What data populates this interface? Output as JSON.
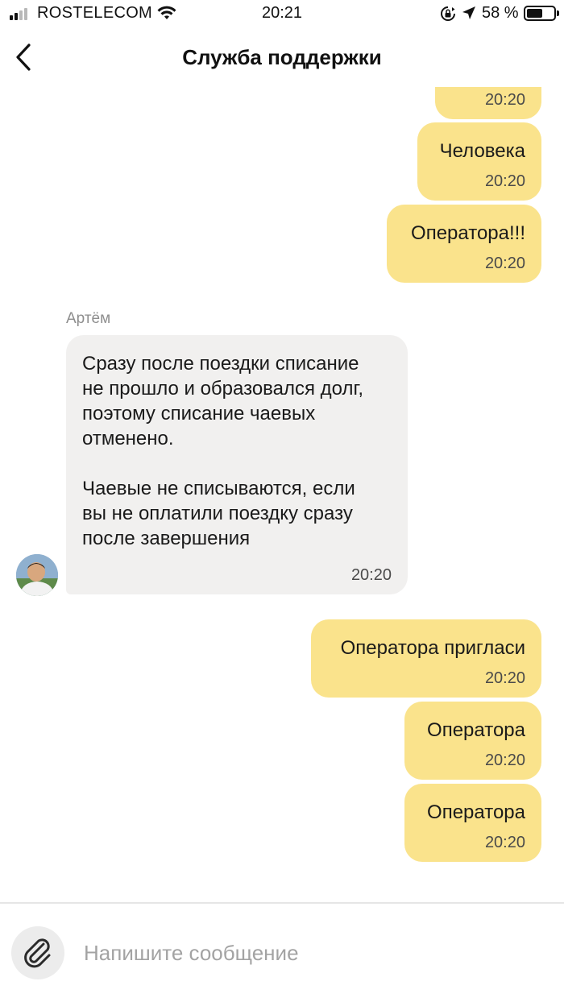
{
  "status_bar": {
    "carrier": "ROSTELECOM",
    "time": "20:21",
    "battery": "58 %"
  },
  "header": {
    "title": "Служба поддержки",
    "back_icon": "chevron-left-icon"
  },
  "messages": [
    {
      "direction": "out",
      "text": "",
      "time": "20:20"
    },
    {
      "direction": "out",
      "text": "Человека",
      "time": "20:20"
    },
    {
      "direction": "out",
      "text": "Оператора!!!",
      "time": "20:20"
    },
    {
      "direction": "in",
      "sender": "Артём",
      "text": "Сразу после поездки списание\nне прошло и образовался долг,\nпоэтому списание чаевых\nотменено.\n\nЧаевые не списываются, если\nвы не оплатили поездку сразу\nпосле завершения",
      "time": "20:20"
    },
    {
      "direction": "out",
      "text": "Оператора пригласи",
      "time": "20:20"
    },
    {
      "direction": "out",
      "text": "Оператора",
      "time": "20:20"
    },
    {
      "direction": "out",
      "text": "Оператора",
      "time": "20:20"
    }
  ],
  "composer": {
    "placeholder": "Напишите сообщение",
    "value": "",
    "attach_icon": "paperclip-icon"
  },
  "colors": {
    "outgoing_bubble": "#fae38c",
    "incoming_bubble": "#f1f0ef"
  }
}
